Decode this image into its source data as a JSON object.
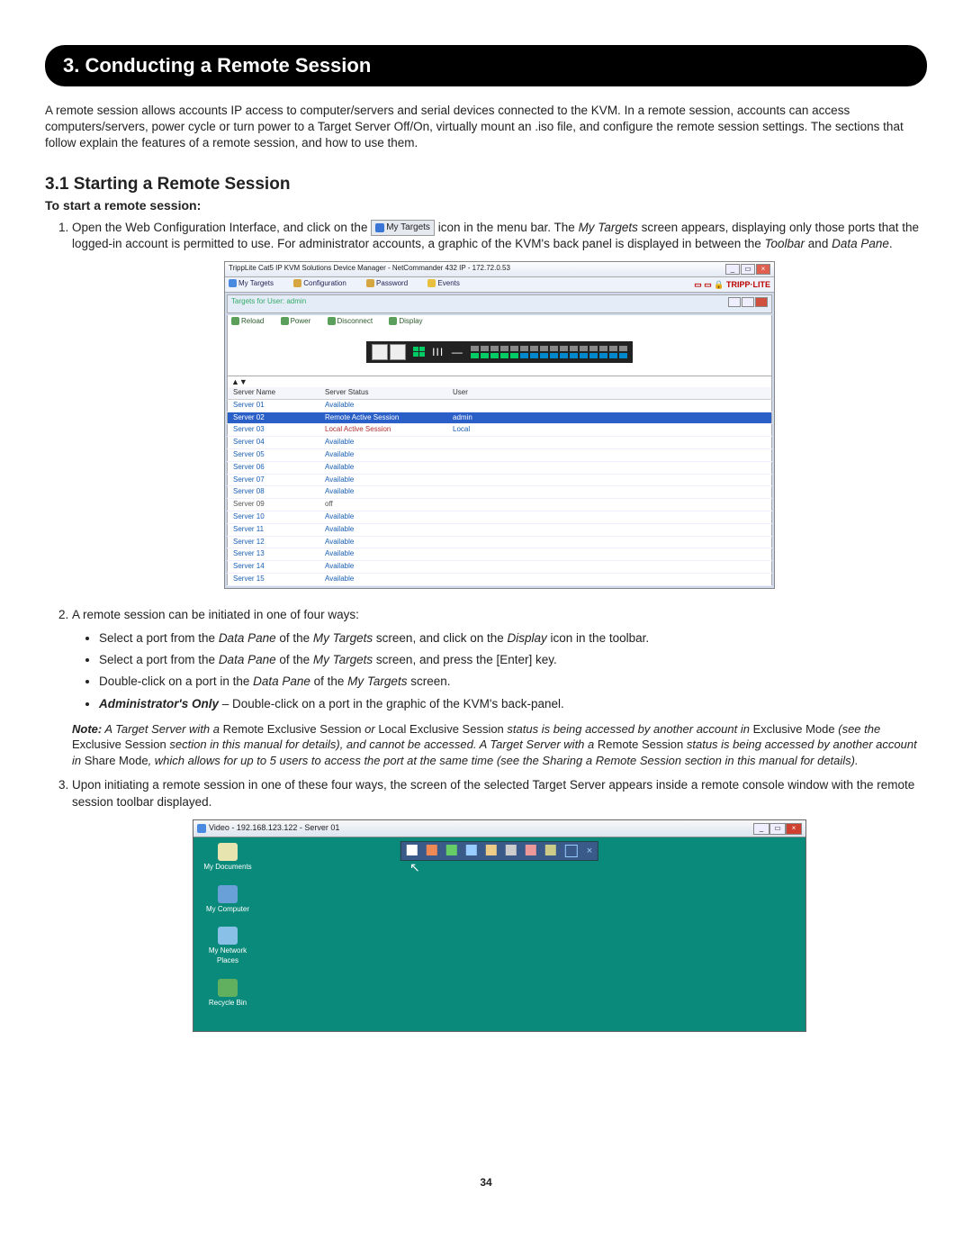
{
  "section_title": "3. Conducting a Remote Session",
  "intro": "A remote session allows accounts IP access to computer/servers and serial devices connected to the KVM. In a remote session, accounts can access computers/servers, power cycle or turn power to a Target Server Off/On, virtually mount an .iso file, and configure the remote session settings. The sections that follow explain the features of a remote session, and how to use them.",
  "subsection_title": "3.1 Starting a Remote Session",
  "lead_bold": "To start a remote session:",
  "step1_a": "Open the Web Configuration Interface, and click on the ",
  "my_targets_badge": "My Targets",
  "step1_b": " icon in the menu bar. The ",
  "step1_c": "My Targets",
  "step1_d": " screen appears, displaying only those ports that the logged-in account is permitted to use. For administrator accounts, a graphic of the KVM's back panel is displayed in between the ",
  "step1_e": "Toolbar",
  "step1_f": " and ",
  "step1_g": "Data Pane",
  "step1_h": ".",
  "screenshot1": {
    "title": "TrippLite Cat5 IP KVM Solutions Device Manager - NetCommander 432 IP - 172.72.0.53",
    "tabs": {
      "t1": "My Targets",
      "t2": "Configuration",
      "t3": "Password",
      "t4": "Events"
    },
    "logo": "TRIPP·LITE",
    "subbar": "Targets for User: admin",
    "toolbar": {
      "b1": "Reload",
      "b2": "Power",
      "b3": "Disconnect",
      "b4": "Display"
    },
    "table": {
      "h1": "Server Name",
      "h2": "Server Status",
      "h3": "User",
      "rows": [
        {
          "name": "Server 01",
          "status": "Available",
          "user": ""
        },
        {
          "name": "Server 02",
          "status": "Remote Active Session",
          "user": "admin",
          "hl": true
        },
        {
          "name": "Server 03",
          "status": "Local Active Session",
          "user": "Local",
          "local": true
        },
        {
          "name": "Server 04",
          "status": "Available",
          "user": ""
        },
        {
          "name": "Server 05",
          "status": "Available",
          "user": ""
        },
        {
          "name": "Server 06",
          "status": "Available",
          "user": ""
        },
        {
          "name": "Server 07",
          "status": "Available",
          "user": ""
        },
        {
          "name": "Server 08",
          "status": "Available",
          "user": ""
        },
        {
          "name": "Server 09",
          "status": "off",
          "user": "",
          "off": true
        },
        {
          "name": "Server 10",
          "status": "Available",
          "user": ""
        },
        {
          "name": "Server 11",
          "status": "Available",
          "user": ""
        },
        {
          "name": "Server 12",
          "status": "Available",
          "user": ""
        },
        {
          "name": "Server 13",
          "status": "Available",
          "user": ""
        },
        {
          "name": "Server 14",
          "status": "Available",
          "user": ""
        },
        {
          "name": "Server 15",
          "status": "Available",
          "user": ""
        }
      ]
    }
  },
  "step2_intro": "A remote session can be initiated in one of four ways:",
  "step2_b1_a": "Select a port from the ",
  "step2_b1_b": "Data Pane",
  "step2_b1_c": " of the ",
  "step2_b1_d": "My Targets",
  "step2_b1_e": " screen, and click on the ",
  "step2_b1_f": "Display",
  "step2_b1_g": " icon in the toolbar.",
  "step2_b2_a": "Select a port from the ",
  "step2_b2_b": "Data Pane",
  "step2_b2_c": " of the ",
  "step2_b2_d": "My Targets",
  "step2_b2_e": " screen, and press the [Enter] key.",
  "step2_b3_a": "Double-click on a port in the ",
  "step2_b3_b": "Data Pane",
  "step2_b3_c": " of the ",
  "step2_b3_d": "My Targets",
  "step2_b3_e": " screen.",
  "step2_b4_a": "Administrator's Only",
  "step2_b4_b": " – Double-click on a port in the graphic of the KVM's back-panel.",
  "note_a": "Note:",
  "note_b": " A Target Server with a ",
  "note_c": "Remote Exclusive Session",
  "note_d": " or ",
  "note_e": "Local Exclusive Session ",
  "note_f": "status is being accessed by another account in ",
  "note_g": "Exclusive Mode ",
  "note_h": "(see the ",
  "note_i": "Exclusive Session ",
  "note_j": "section in this manual for details), and cannot be accessed. A Target Server with a ",
  "note_k": "Remote Session ",
  "note_l": "status is being accessed by another account in ",
  "note_m": "Share Mode",
  "note_n": ", which allows for up to 5 users to access the port at the same time (see the Sharing a Remote Session section in this manual for details).",
  "step3": "Upon initiating a remote session in one of these four ways, the screen of the selected Target Server appears inside a remote console window with the remote session toolbar displayed.",
  "screenshot2": {
    "title": "Video - 192.168.123.122 - Server 01",
    "icons": {
      "docs": "My Documents",
      "comp": "My Computer",
      "net": "My Network Places",
      "bin": "Recycle Bin"
    }
  },
  "page_number": "34"
}
